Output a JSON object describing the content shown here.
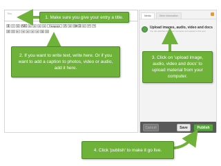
{
  "editor": {
    "title_placeholder": "Title",
    "toolbar_row1": [
      "B",
      "I",
      "U",
      "ABC",
      "≡",
      "≡",
      "≡",
      "≡",
      "⇥"
    ],
    "paragraph_select": "Paragraph",
    "toolbar_row1_tail": [
      "A",
      "▾",
      "⌫",
      "Ω",
      "⇤",
      "↶",
      "↷"
    ],
    "toolbar_row2": [
      "☰",
      "☷",
      "⇤",
      "⇥",
      "≡",
      "≡",
      "≡",
      "⊞",
      "⊟"
    ]
  },
  "side_panel": {
    "tabs": [
      "Media",
      "Other information"
    ],
    "upload": {
      "title": "Upload images, audio, video and docs",
      "subtitle": "You can add files from your computer and upload to this post"
    }
  },
  "action_bar": {
    "cancel_label": "Cancel",
    "save_label": "Save",
    "publish_label": "Publish"
  },
  "callouts": {
    "step1": "1. Make sure you give your entry a title.",
    "step2": "2. If you want to write text, write here. Or if you want to add a caption to photos, video or audio, add it here.",
    "step3": "3. Click on 'upload image, audio, video and docs' to upload material from your computer.",
    "step4": "4. Click 'publish' to make it go live."
  },
  "colors": {
    "callout_green": "#6fb23a",
    "publish_green": "#5aa63e",
    "action_bar": "#595959"
  }
}
